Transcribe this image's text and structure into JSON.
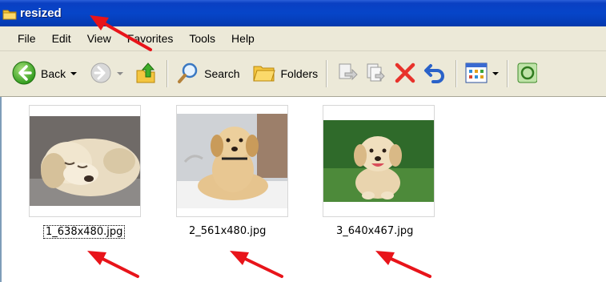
{
  "window": {
    "title": "resized"
  },
  "menu": {
    "items": [
      "File",
      "Edit",
      "View",
      "Favorites",
      "Tools",
      "Help"
    ]
  },
  "toolbar": {
    "back_label": "Back",
    "search_label": "Search",
    "folders_label": "Folders"
  },
  "files": [
    {
      "name": "1_638x480.jpg",
      "selected": true
    },
    {
      "name": "2_561x480.jpg",
      "selected": false
    },
    {
      "name": "3_640x467.jpg",
      "selected": false
    }
  ],
  "colors": {
    "titlebar": "#0645c9",
    "chrome": "#ece9d8",
    "annotation_arrow": "#e8141a"
  }
}
